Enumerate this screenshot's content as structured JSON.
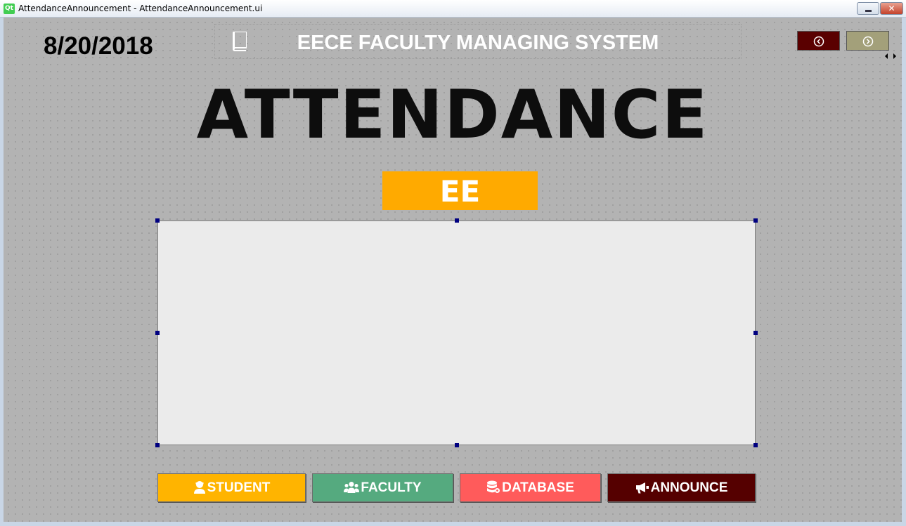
{
  "window": {
    "title": "AttendanceAnnouncement - AttendanceAnnouncement.ui",
    "app_icon_text": "Qt",
    "close_glyph": "✕"
  },
  "header": {
    "date": "8/20/2018",
    "system_title": "EECE FACULTY MANAGING SYSTEM",
    "book_icon": "book-icon",
    "prev_icon": "chevron-left-circle-icon",
    "next_icon": "chevron-right-circle-icon"
  },
  "page": {
    "title": "ATTENDANCE",
    "department": "EE"
  },
  "nav_buttons": {
    "student": "STUDENT",
    "faculty": "FACULTY",
    "database": "DATABASE",
    "announce": "ANNOUNCE"
  },
  "colors": {
    "department_badge": "#ffaa00",
    "student": "#ffb400",
    "faculty": "#55aa7f",
    "database": "#ff5b5b",
    "announce": "#550000",
    "prev_button": "#5a0000",
    "next_button": "#a3a07a",
    "background": "#b3b3b3"
  }
}
